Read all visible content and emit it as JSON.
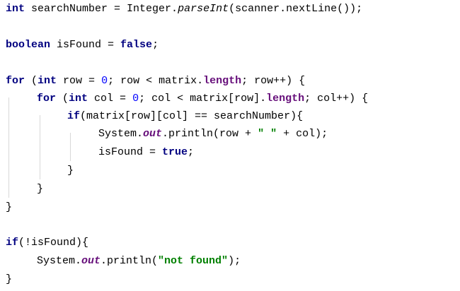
{
  "code_lines": [
    {
      "line": 1,
      "tokens": [
        "int",
        " searchNumber = Integer.",
        "parseInt",
        "(scanner.nextLine());"
      ]
    },
    {
      "line": 3,
      "tokens": [
        "boolean",
        " isFound = ",
        "false",
        ";"
      ]
    },
    {
      "line": 5,
      "tokens": [
        "for",
        " (",
        "int",
        " row = ",
        "0",
        "; row < matrix.",
        "length",
        "; row++) {"
      ]
    },
    {
      "line": 6,
      "tokens": [
        "for",
        " (",
        "int",
        " col = ",
        "0",
        "; col < matrix[row].",
        "length",
        "; col++) {"
      ]
    },
    {
      "line": 7,
      "tokens": [
        "if",
        "(matrix[row][col] == searchNumber){"
      ]
    },
    {
      "line": 8,
      "tokens": [
        "System.",
        "out",
        ".println(row + ",
        "\" \"",
        " + col);"
      ]
    },
    {
      "line": 9,
      "tokens": [
        "isFound = ",
        "true",
        ";"
      ]
    },
    {
      "line": 10,
      "tokens": [
        "}"
      ]
    },
    {
      "line": 11,
      "tokens": [
        "}"
      ]
    },
    {
      "line": 12,
      "tokens": [
        "}"
      ]
    },
    {
      "line": 14,
      "tokens": [
        "if",
        "(!isFound){"
      ]
    },
    {
      "line": 15,
      "tokens": [
        "System.",
        "out",
        ".println(",
        "\"not found\"",
        ");"
      ]
    },
    {
      "line": 16,
      "tokens": [
        "}"
      ]
    }
  ],
  "colors": {
    "keyword": "#000080",
    "number": "#0000ff",
    "string": "#008000",
    "field": "#660e7a",
    "indent_guide": "#d8d8d8",
    "background": "#ffffff"
  }
}
